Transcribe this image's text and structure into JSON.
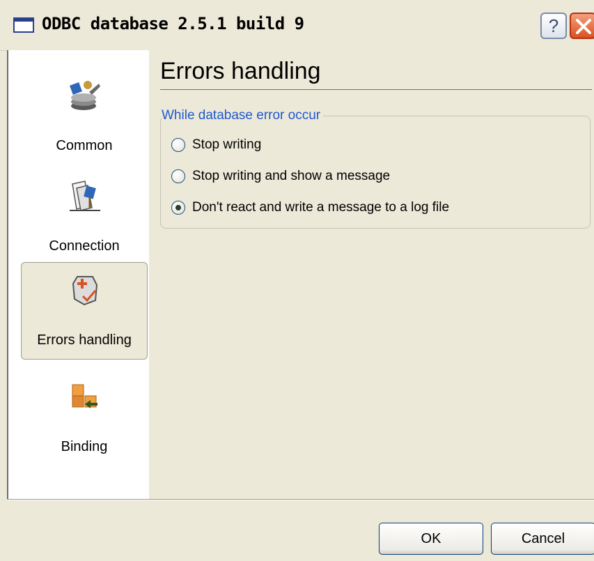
{
  "window": {
    "title": "ODBC database 2.5.1 build 9",
    "help_label": "?",
    "close_icon": "close-icon"
  },
  "sidebar": {
    "items": [
      {
        "label": "Common",
        "icon": "database-common-icon",
        "active": false
      },
      {
        "label": "Connection",
        "icon": "connection-icon",
        "active": false
      },
      {
        "label": "Errors handling",
        "icon": "errors-handling-icon",
        "active": true
      },
      {
        "label": "Binding",
        "icon": "binding-icon",
        "active": false
      }
    ]
  },
  "main": {
    "title": "Errors handling",
    "group": {
      "legend": "While database error occur",
      "options": [
        {
          "label": "Stop writing",
          "checked": false
        },
        {
          "label": "Stop writing and show a message",
          "checked": false
        },
        {
          "label": "Don't react and write a message to a log file",
          "checked": true
        }
      ]
    }
  },
  "buttons": {
    "ok": "OK",
    "cancel": "Cancel"
  },
  "colors": {
    "legend": "#1f58d1",
    "background": "#ece9d8",
    "close_button": "#d9521f"
  }
}
